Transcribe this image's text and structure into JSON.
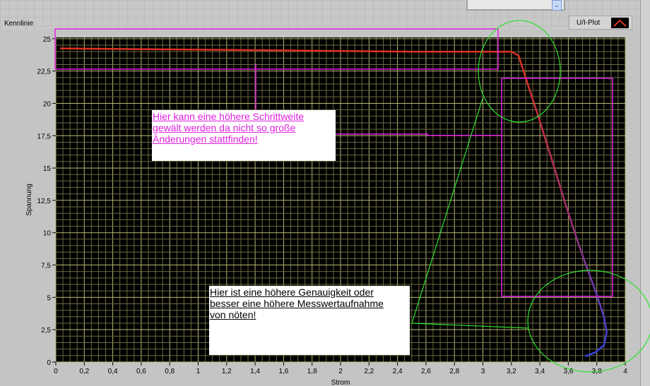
{
  "graph": {
    "label": "Kennlinie",
    "legend_name": "U/I-Plot"
  },
  "colors": {
    "plot_bg": "#000000",
    "grid_major": "#b8b870",
    "grid_minor": "#6a6a40",
    "curve_top": "#e03020",
    "curve_bottom": "#3a44e8",
    "annotation_magenta": "#e020e0",
    "annotation_green": "#30e030"
  },
  "annotations": {
    "note1": [
      "Hier kann eine höhere Schrittweite ",
      "gewält werden da nicht so große",
      "Änderungen stattfinden!"
    ],
    "note2": [
      "Hier ist eine höhere Genauigkeit oder",
      "besser eine höhere Messwertaufnahme ",
      "von nöten!"
    ]
  },
  "chart_data": {
    "type": "line",
    "title": "Kennlinie",
    "xlabel": "Strom",
    "ylabel": "Spannung",
    "xlim": [
      0,
      4
    ],
    "ylim": [
      0,
      25.1
    ],
    "xticks": [
      "0",
      "0,2",
      "0,4",
      "0,6",
      "0,8",
      "1",
      "1,2",
      "1,4",
      "1,6",
      "1,8",
      "2",
      "2,2",
      "2,4",
      "2,6",
      "2,8",
      "3",
      "3,2",
      "3,4",
      "3,6",
      "3,8",
      "4"
    ],
    "yticks": [
      "0",
      "2,5",
      "5",
      "7,5",
      "10",
      "12,5",
      "15",
      "17,5",
      "20",
      "22,5",
      "25"
    ],
    "grid": true,
    "legend": "top-right",
    "series": [
      {
        "name": "U/I-Plot",
        "x": [
          0.03,
          0.5,
          1.0,
          1.5,
          2.0,
          2.5,
          3.0,
          3.2,
          3.25,
          3.3,
          3.38,
          3.48,
          3.58,
          3.66,
          3.73,
          3.8,
          3.85,
          3.87,
          3.85,
          3.79,
          3.72
        ],
        "y": [
          24.25,
          24.2,
          24.15,
          24.1,
          24.05,
          24.0,
          24.0,
          24.0,
          23.7,
          22.0,
          19.3,
          15.8,
          12.2,
          9.5,
          7.3,
          5.2,
          3.5,
          2.3,
          1.3,
          0.75,
          0.45
        ]
      }
    ]
  }
}
